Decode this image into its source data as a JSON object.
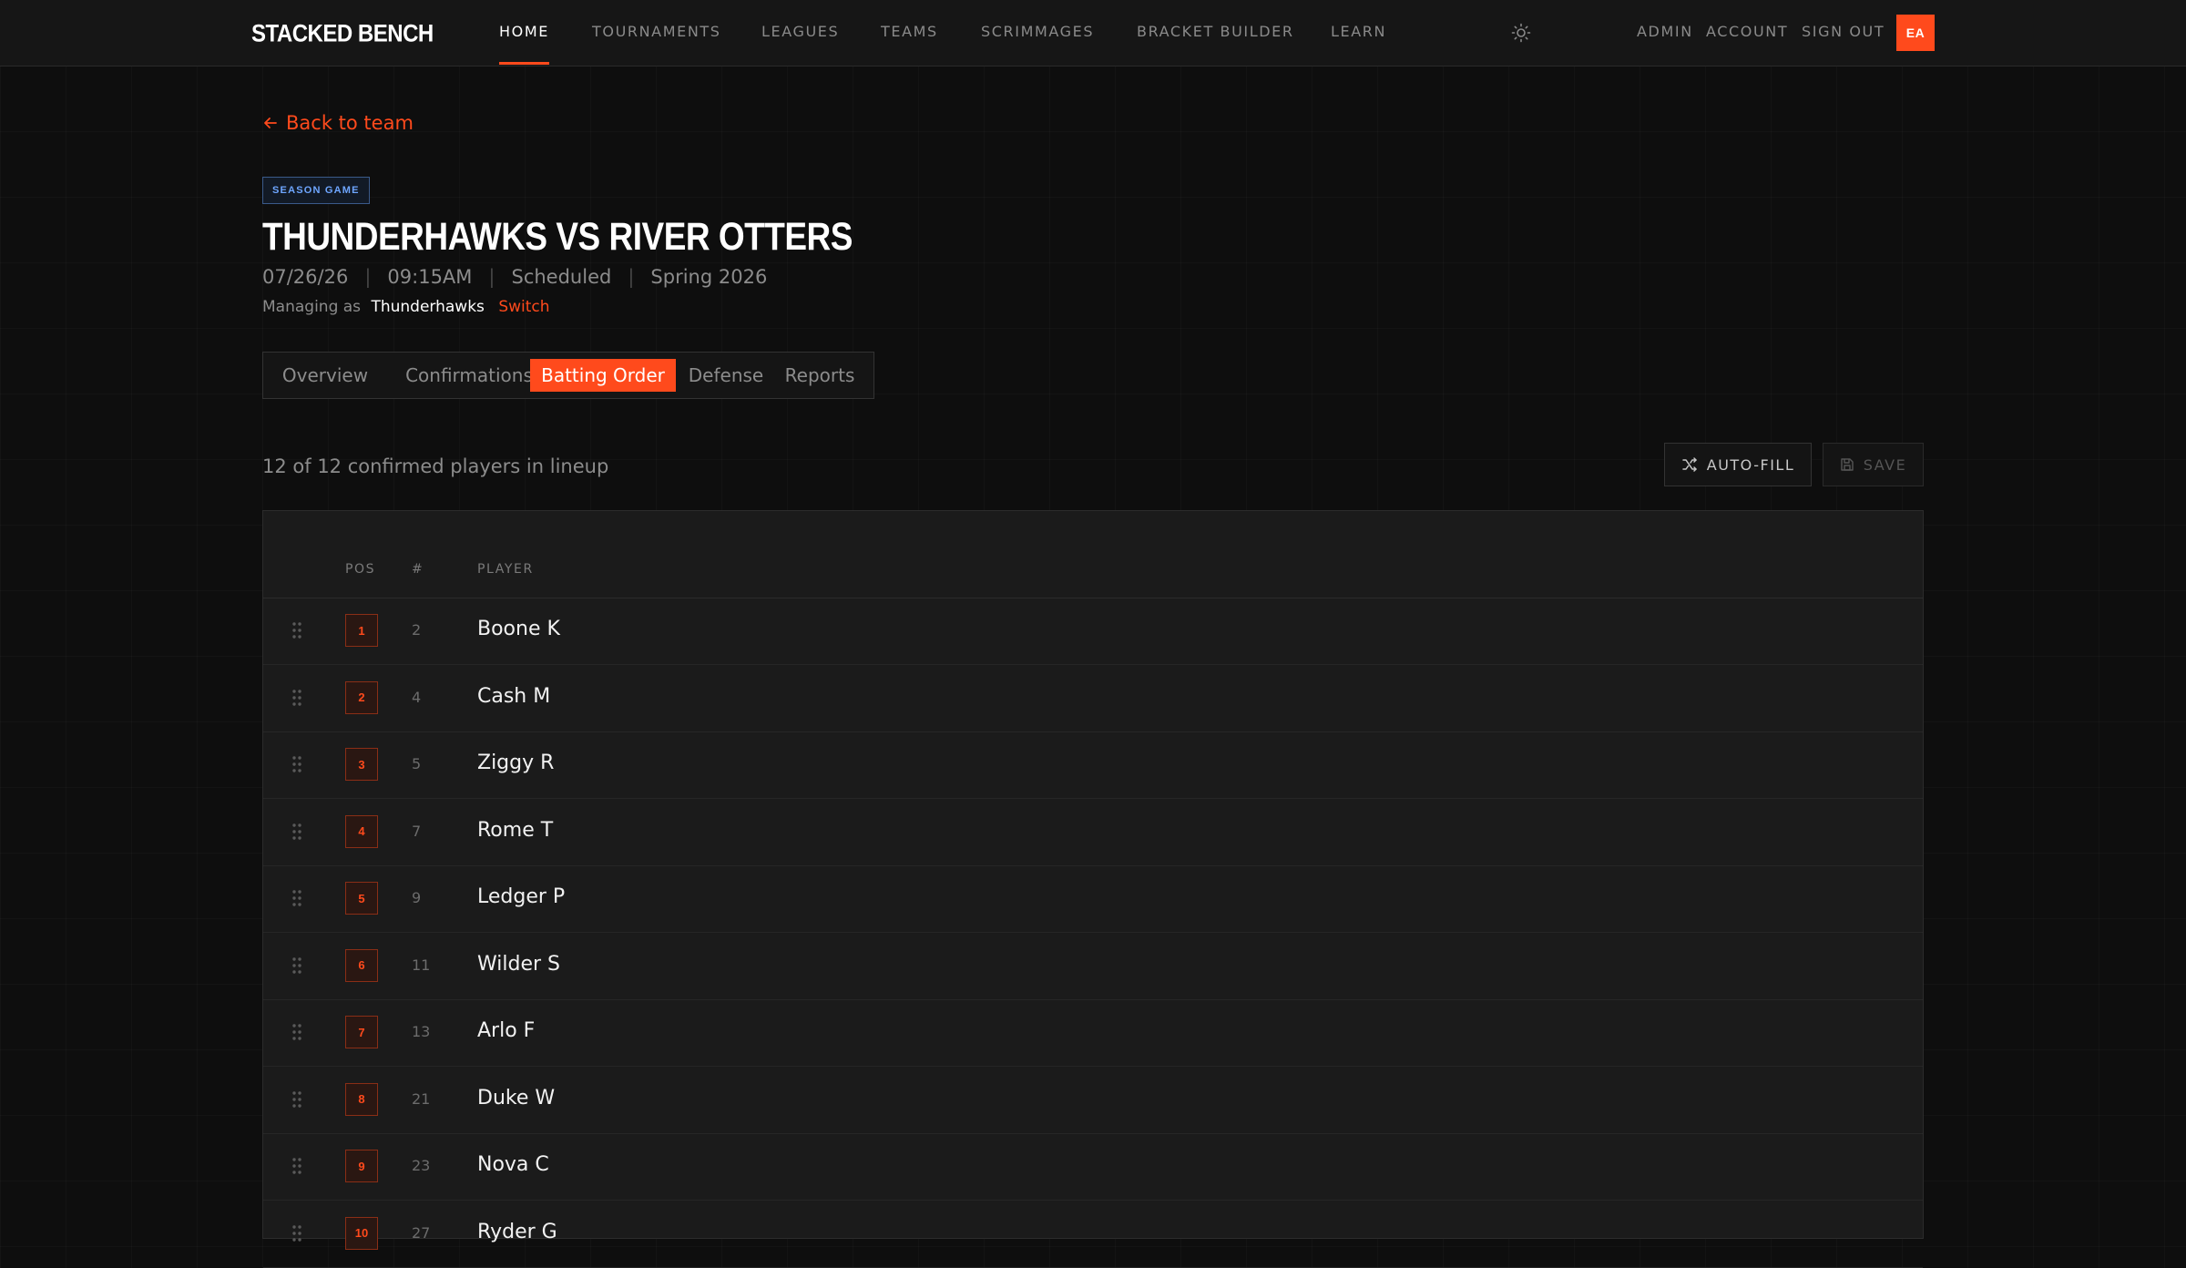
{
  "brand": "STACKED BENCH",
  "nav": {
    "items": [
      "HOME",
      "TOURNAMENTS",
      "LEAGUES",
      "TEAMS",
      "SCRIMMAGES",
      "BRACKET BUILDER",
      "LEARN"
    ],
    "right_items": [
      "ADMIN",
      "ACCOUNT",
      "SIGN OUT"
    ],
    "avatar_initials": "EA",
    "theme_icon": "sun-icon"
  },
  "page": {
    "back_label": "Back to team",
    "badge": "SEASON GAME",
    "title": "THUNDERHAWKS VS RIVER OTTERS",
    "meta": [
      "07/26/26",
      "09:15AM",
      "Scheduled",
      "Spring 2026"
    ],
    "managing_prefix": "Managing as",
    "managing_team": "Thunderhawks",
    "switch_label": "Switch"
  },
  "tabs": [
    "Overview",
    "Confirmations",
    "Batting Order",
    "Defense",
    "Reports"
  ],
  "lineup": {
    "count_text": "12 of 12 confirmed players in lineup",
    "autofill_label": "AUTO-FILL",
    "save_label": "SAVE"
  },
  "table": {
    "headers": {
      "pos": "POS",
      "num": "#",
      "player": "PLAYER"
    },
    "rows": [
      {
        "pos": "1",
        "num": "2",
        "player": "Boone K"
      },
      {
        "pos": "2",
        "num": "4",
        "player": "Cash M"
      },
      {
        "pos": "3",
        "num": "5",
        "player": "Ziggy R"
      },
      {
        "pos": "4",
        "num": "7",
        "player": "Rome T"
      },
      {
        "pos": "5",
        "num": "9",
        "player": "Ledger P"
      },
      {
        "pos": "6",
        "num": "11",
        "player": "Wilder S"
      },
      {
        "pos": "7",
        "num": "13",
        "player": "Arlo F"
      },
      {
        "pos": "8",
        "num": "21",
        "player": "Duke W"
      },
      {
        "pos": "9",
        "num": "23",
        "player": "Nova C"
      },
      {
        "pos": "10",
        "num": "27",
        "player": "Ryder G"
      }
    ]
  },
  "colors": {
    "accent": "#ff4a1c",
    "badge": "#6ea6ff",
    "background": "#0e0e0e"
  }
}
